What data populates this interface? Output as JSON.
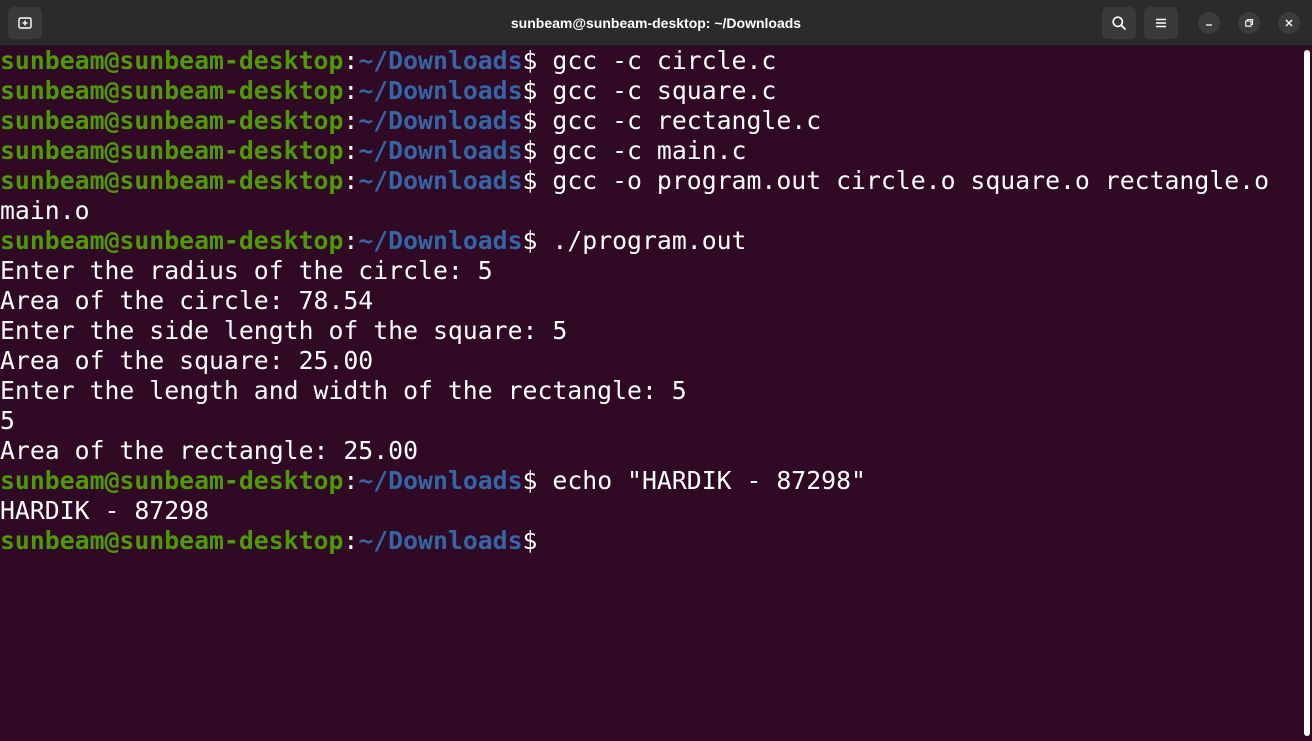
{
  "window": {
    "title": "sunbeam@sunbeam-desktop: ~/Downloads"
  },
  "icons": {
    "new_tab": "new-tab-icon",
    "search": "search-icon",
    "menu": "hamburger-menu-icon",
    "minimize": "minimize-icon",
    "maximize": "restore-icon",
    "close": "close-icon"
  },
  "colors": {
    "background": "#300a24",
    "user_host": "#4e9a06",
    "path": "#3465a4",
    "text": "#ffffff",
    "titlebar": "#2b2b2b"
  },
  "terminal": {
    "prompt": {
      "user_host": "sunbeam@sunbeam-desktop",
      "colon": ":",
      "path": "~/Downloads",
      "symbol": "$"
    },
    "lines": [
      {
        "type": "prompt",
        "command": " gcc -c circle.c"
      },
      {
        "type": "prompt",
        "command": " gcc -c square.c"
      },
      {
        "type": "prompt",
        "command": " gcc -c rectangle.c"
      },
      {
        "type": "prompt",
        "command": " gcc -c main.c"
      },
      {
        "type": "prompt",
        "command": " gcc -o program.out circle.o square.o rectangle.o"
      },
      {
        "type": "output",
        "text": "main.o"
      },
      {
        "type": "prompt",
        "command": " ./program.out"
      },
      {
        "type": "output",
        "text": "Enter the radius of the circle: 5"
      },
      {
        "type": "output",
        "text": "Area of the circle: 78.54"
      },
      {
        "type": "output",
        "text": "Enter the side length of the square: 5"
      },
      {
        "type": "output",
        "text": "Area of the square: 25.00"
      },
      {
        "type": "output",
        "text": "Enter the length and width of the rectangle: 5"
      },
      {
        "type": "output",
        "text": "5"
      },
      {
        "type": "output",
        "text": "Area of the rectangle: 25.00"
      },
      {
        "type": "prompt",
        "command": " echo \"HARDIK - 87298\""
      },
      {
        "type": "output",
        "text": "HARDIK - 87298"
      },
      {
        "type": "prompt",
        "command": ""
      }
    ]
  }
}
